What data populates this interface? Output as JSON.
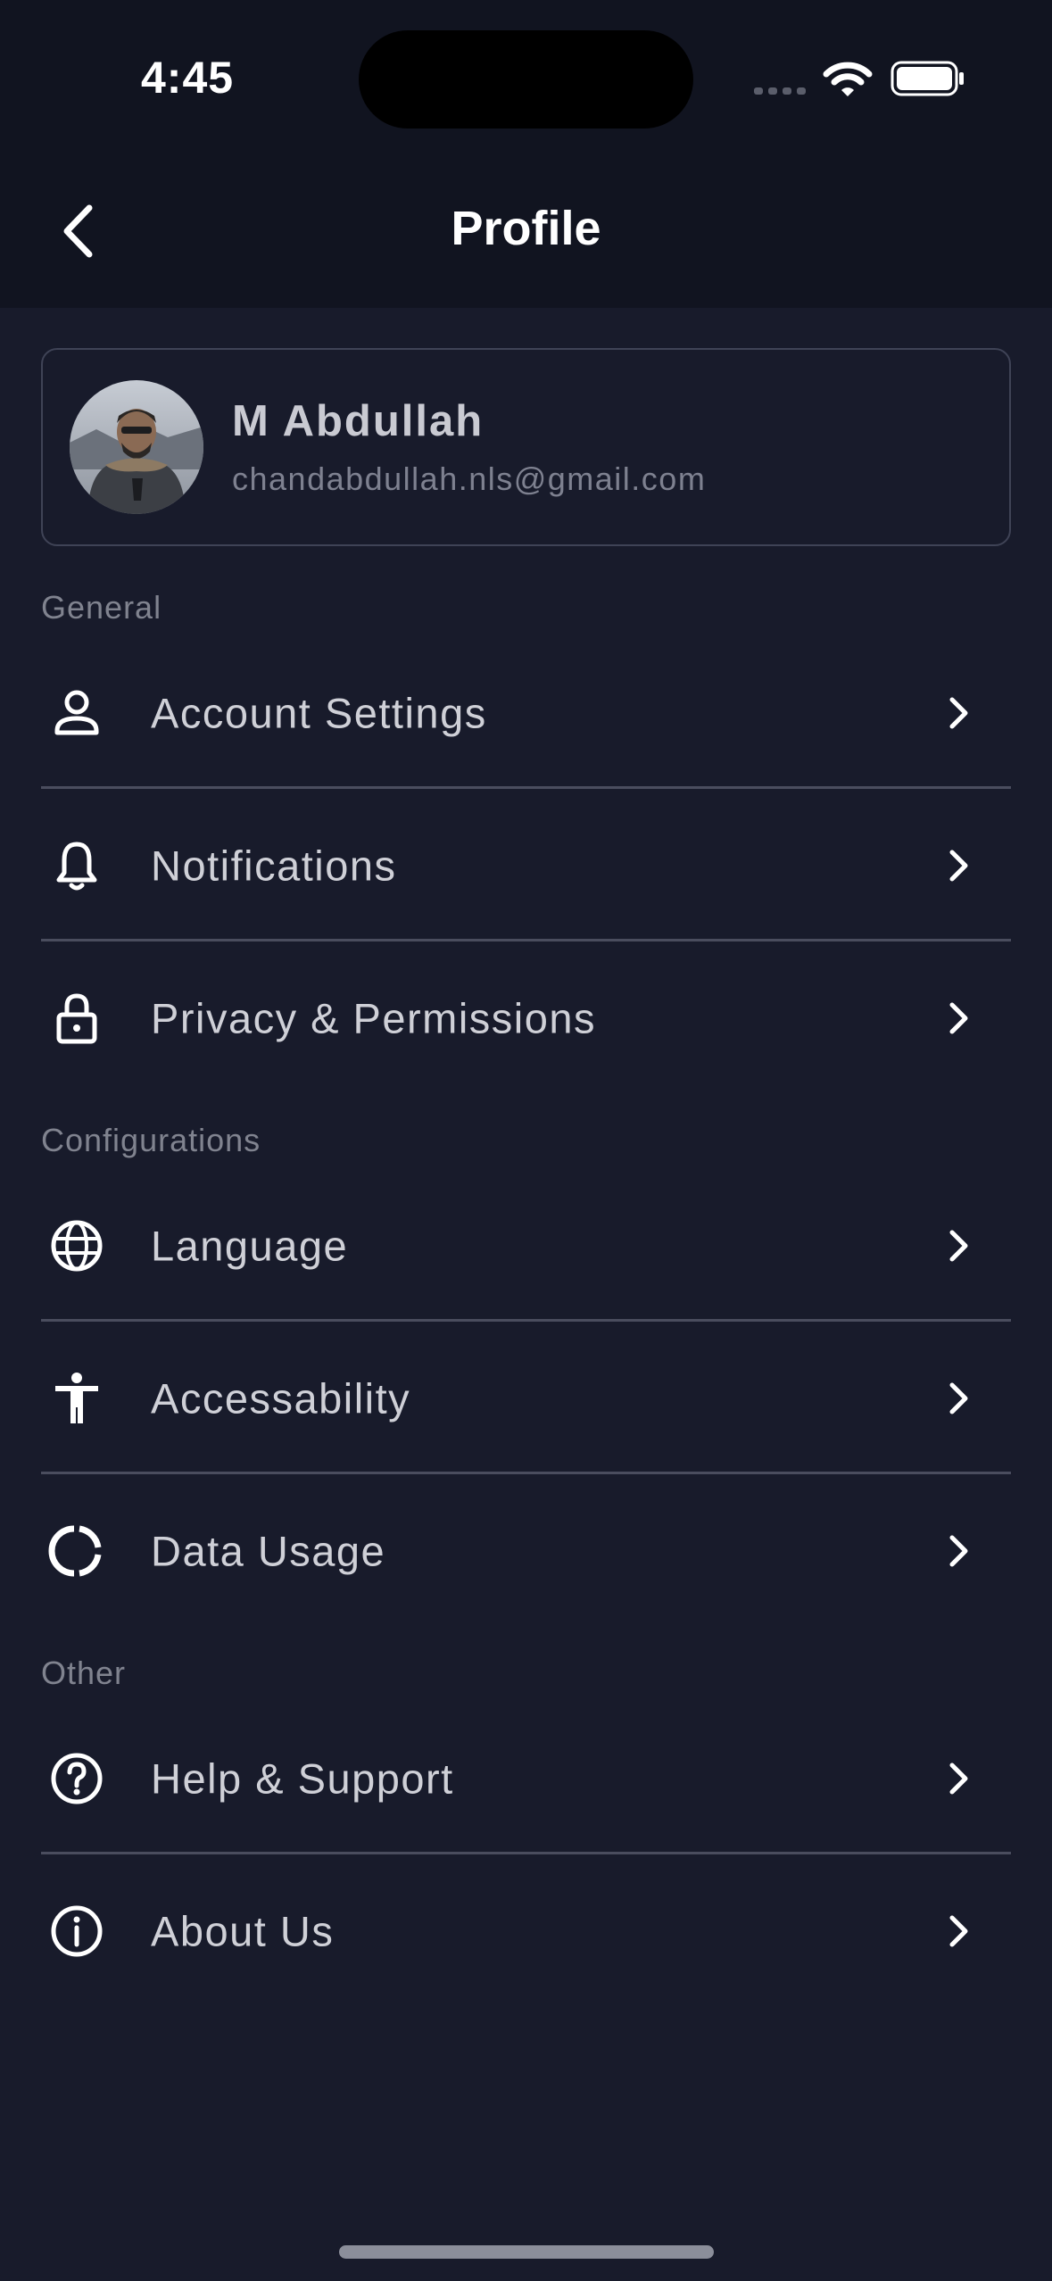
{
  "status_bar": {
    "time": "4:45",
    "icons": [
      "signal-icon",
      "wifi-icon",
      "battery-icon"
    ]
  },
  "header": {
    "title": "Profile",
    "back_icon": "chevron-left-icon"
  },
  "profile": {
    "name": "M Abdullah",
    "email": "chandabdullah.nls@gmail.com"
  },
  "sections": [
    {
      "label": "General",
      "items": [
        {
          "label": "Account Settings",
          "icon": "person-icon"
        },
        {
          "label": "Notifications",
          "icon": "bell-icon"
        },
        {
          "label": "Privacy & Permissions",
          "icon": "lock-icon"
        }
      ]
    },
    {
      "label": "Configurations",
      "items": [
        {
          "label": "Language",
          "icon": "globe-icon"
        },
        {
          "label": "Accessability",
          "icon": "accessibility-icon"
        },
        {
          "label": "Data Usage",
          "icon": "data-usage-icon"
        }
      ]
    },
    {
      "label": "Other",
      "items": [
        {
          "label": "Help & Support",
          "icon": "help-icon"
        },
        {
          "label": "About Us",
          "icon": "info-icon"
        }
      ]
    }
  ],
  "colors": {
    "background": "#181b2b",
    "header_background": "#111420",
    "divider": "#4a4d5e",
    "text_primary": "#cfd0d7",
    "text_muted": "#80838f"
  }
}
